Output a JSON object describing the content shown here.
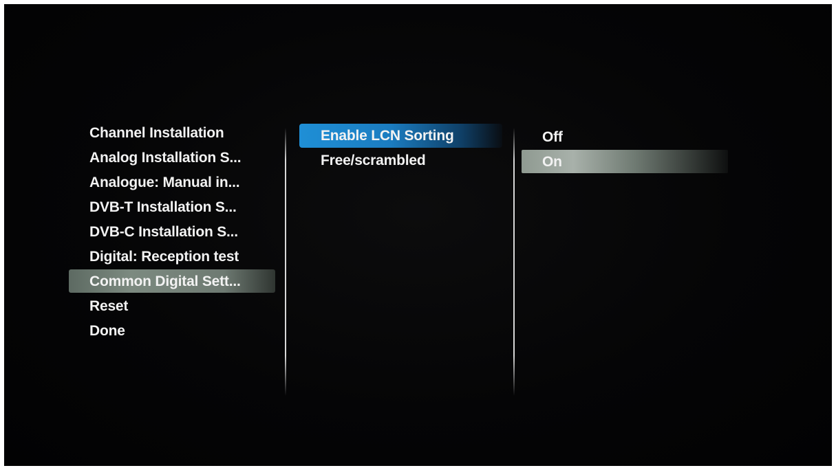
{
  "left_menu": {
    "items": [
      {
        "label": "Channel Installation"
      },
      {
        "label": "Analog Installation S..."
      },
      {
        "label": "Analogue: Manual in..."
      },
      {
        "label": "DVB-T Installation S..."
      },
      {
        "label": "DVB-C Installation S..."
      },
      {
        "label": "Digital: Reception test"
      },
      {
        "label": "Common Digital Sett..."
      },
      {
        "label": "Reset"
      },
      {
        "label": "Done"
      }
    ],
    "selected_index": 6
  },
  "middle_menu": {
    "items": [
      {
        "label": "Enable LCN Sorting"
      },
      {
        "label": "Free/scrambled"
      }
    ],
    "focused_index": 0
  },
  "right_menu": {
    "options": [
      {
        "label": "Off"
      },
      {
        "label": "On"
      }
    ],
    "selected_index": 1
  },
  "colors": {
    "focus_highlight": "#1f8fd6",
    "selection_highlight": "#7c8a80",
    "text": "#f2f2f2",
    "background": "#050506"
  }
}
